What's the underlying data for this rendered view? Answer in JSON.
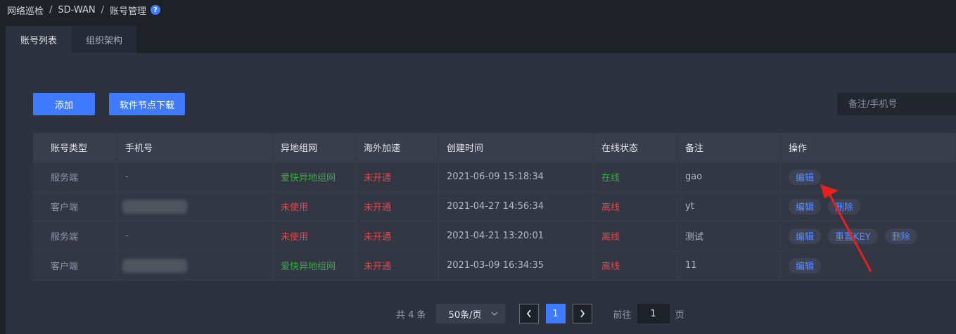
{
  "breadcrumb": {
    "items": [
      "网络巡检",
      "SD-WAN",
      "账号管理"
    ],
    "separator": "/",
    "help": "?"
  },
  "tabs": [
    {
      "label": "账号列表",
      "active": true
    },
    {
      "label": "组织架构",
      "active": false
    }
  ],
  "toolbar": {
    "add_label": "添加",
    "download_label": "软件节点下载",
    "search_placeholder": "备注/手机号"
  },
  "table": {
    "headers": [
      "账号类型",
      "手机号",
      "异地组网",
      "海外加速",
      "创建时间",
      "在线状态",
      "备注",
      "操作"
    ],
    "rows": [
      {
        "type": "服务端",
        "phone": "-",
        "remote": "爱快异地组网",
        "overseas": "未开通",
        "created": "2021-06-09 15:18:34",
        "status": "在线",
        "remark": "gao",
        "ops": [
          "编辑"
        ]
      },
      {
        "type": "客户端",
        "phone": "",
        "remote": "未使用",
        "overseas": "未开通",
        "created": "2021-04-27 14:56:34",
        "status": "离线",
        "remark": "yt",
        "ops": [
          "编辑",
          "删除"
        ]
      },
      {
        "type": "服务端",
        "phone": "-",
        "remote": "未使用",
        "overseas": "未开通",
        "created": "2021-04-21 13:20:01",
        "status": "离线",
        "remark": "测试",
        "ops": [
          "编辑",
          "重置KEY",
          "删除"
        ]
      },
      {
        "type": "客户端",
        "phone": "",
        "remote": "爱快异地组网",
        "overseas": "未开通",
        "created": "2021-03-09 16:34:35",
        "status": "离线",
        "remark": "11",
        "ops": [
          "编辑"
        ]
      }
    ]
  },
  "pagination": {
    "total_text": "共 4 条",
    "page_size": "50条/页",
    "prev": "<",
    "current": "1",
    "next": ">",
    "goto_prefix": "前往",
    "goto_value": "1",
    "goto_suffix": "页"
  },
  "colors": {
    "accent": "#3f7bff",
    "online": "#39a846",
    "offline": "#e64545",
    "annotation_arrow": "#e62020"
  }
}
